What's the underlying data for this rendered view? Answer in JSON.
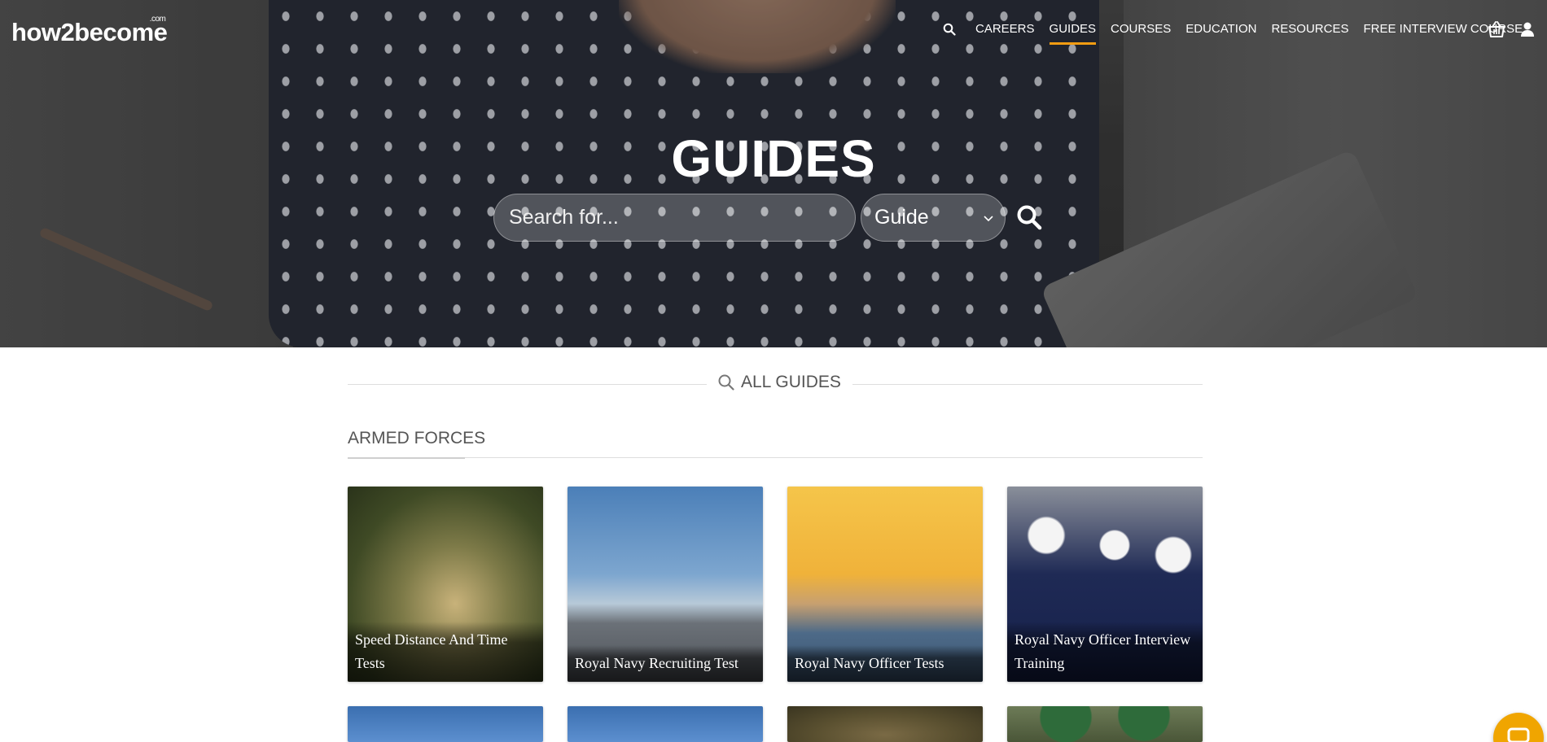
{
  "brand": {
    "name": "how2become",
    "suffix": ".com"
  },
  "nav": {
    "items": [
      {
        "label": "CAREERS",
        "active": false
      },
      {
        "label": "GUIDES",
        "active": true
      },
      {
        "label": "COURSES",
        "active": false
      },
      {
        "label": "EDUCATION",
        "active": false
      },
      {
        "label": "RESOURCES",
        "active": false
      },
      {
        "label": "FREE INTERVIEW COURSE",
        "active": false
      }
    ],
    "icons": [
      "search-icon",
      "basket-icon",
      "user-icon"
    ],
    "active_color": "#f39c12"
  },
  "hero": {
    "title": "GUIDES",
    "search_placeholder": "Search for...",
    "select_value": "Guide"
  },
  "content": {
    "all_guides_label": "ALL GUIDES",
    "category": "ARMED FORCES",
    "cards": [
      {
        "title": "Speed Distance And Time Tests"
      },
      {
        "title": "Royal Navy Recruiting Test"
      },
      {
        "title": "Royal Navy Officer Tests"
      },
      {
        "title": "Royal Navy Officer Interview Training"
      }
    ]
  },
  "chat": {
    "icon": "chat-icon",
    "color": "#f0a500"
  }
}
